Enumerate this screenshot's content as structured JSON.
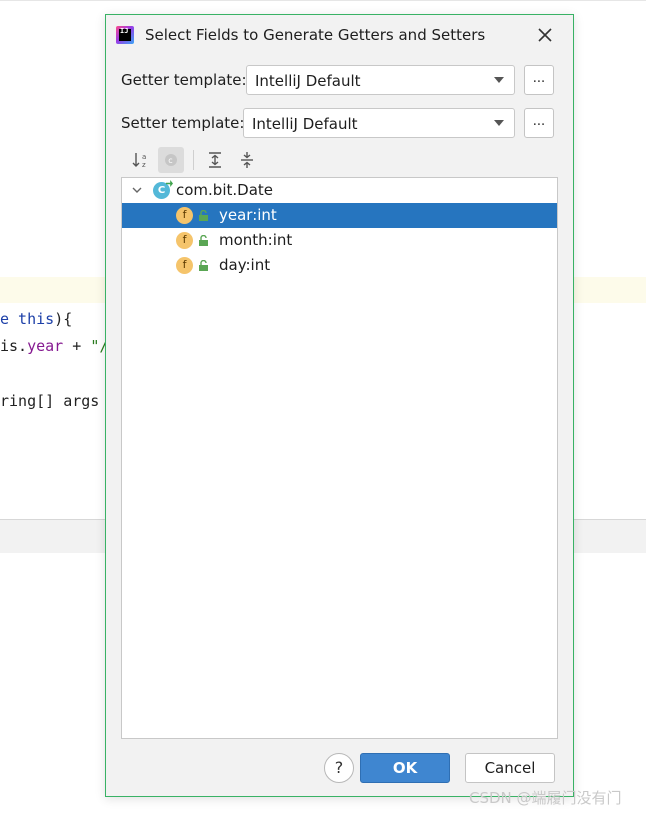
{
  "editor": {
    "line1": {
      "kw": "e this",
      "rest": "){"
    },
    "line2": {
      "a": "is.",
      "field": "year",
      "b": " + ",
      "str": "\"/"
    },
    "line3": {
      "text": "ring[] args"
    }
  },
  "dialog": {
    "title": "Select Fields to Generate Getters and Setters",
    "getter_label": "Getter template:",
    "getter_value": "IntelliJ Default",
    "setter_label": "Setter template:",
    "setter_value": "IntelliJ Default",
    "dots_label": "...",
    "tree": {
      "root_label": "com.bit.Date",
      "class_icon_letter": "C",
      "field_icon_letter": "f",
      "fields": [
        {
          "label": "year:int",
          "selected": true
        },
        {
          "label": "month:int",
          "selected": false
        },
        {
          "label": "day:int",
          "selected": false
        }
      ]
    },
    "buttons": {
      "help": "?",
      "ok": "OK",
      "cancel": "Cancel"
    }
  },
  "watermark": "CSDN @端履门没有门",
  "colors": {
    "selection": "#2675bf",
    "ok_button": "#3f86d0",
    "dialog_border": "#39b265"
  }
}
